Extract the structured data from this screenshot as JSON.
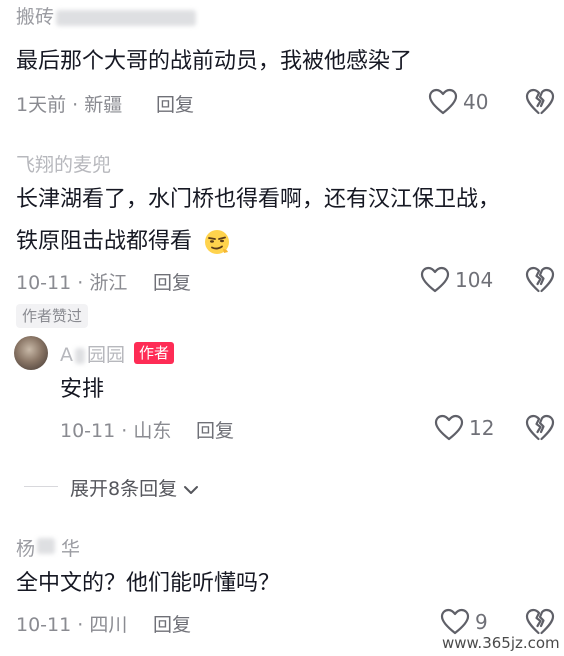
{
  "comments": [
    {
      "username_visible": "搬砖",
      "text": "最后那个大哥的战前动员，我被他感染了",
      "date": "1天前",
      "location": "新疆",
      "reply_label": "回复",
      "likes": "40"
    },
    {
      "username_visible": "飞翔的麦兜",
      "text_line1": "长津湖看了，水门桥也得看啊，还有汉江保卫战，",
      "text_line2": "铁原阻击战都得看",
      "date": "10-11",
      "location": "浙江",
      "reply_label": "回复",
      "likes": "104",
      "liked_by_author_badge": "作者赞过"
    },
    {
      "username_visible": "杨华",
      "text": "全中文的？他们能听懂吗？",
      "date": "10-11",
      "location": "四川",
      "reply_label": "回复",
      "likes": "9"
    }
  ],
  "author_reply": {
    "username_visible": "A",
    "username_suffix": "园园",
    "author_tag": "作者",
    "text": "安排",
    "date": "10-11",
    "location": "山东",
    "reply_label": "回复",
    "likes": "12"
  },
  "expand_replies": "展开8条回复",
  "separator": "·",
  "watermark": "www.365jz.com",
  "colors": {
    "author_tag": "#fe2c55",
    "text": "#161823",
    "meta": "#8a8b91"
  },
  "icons": [
    "heart-outline-icon",
    "broken-heart-icon",
    "smirk-emoji-icon",
    "chevron-down-icon"
  ]
}
